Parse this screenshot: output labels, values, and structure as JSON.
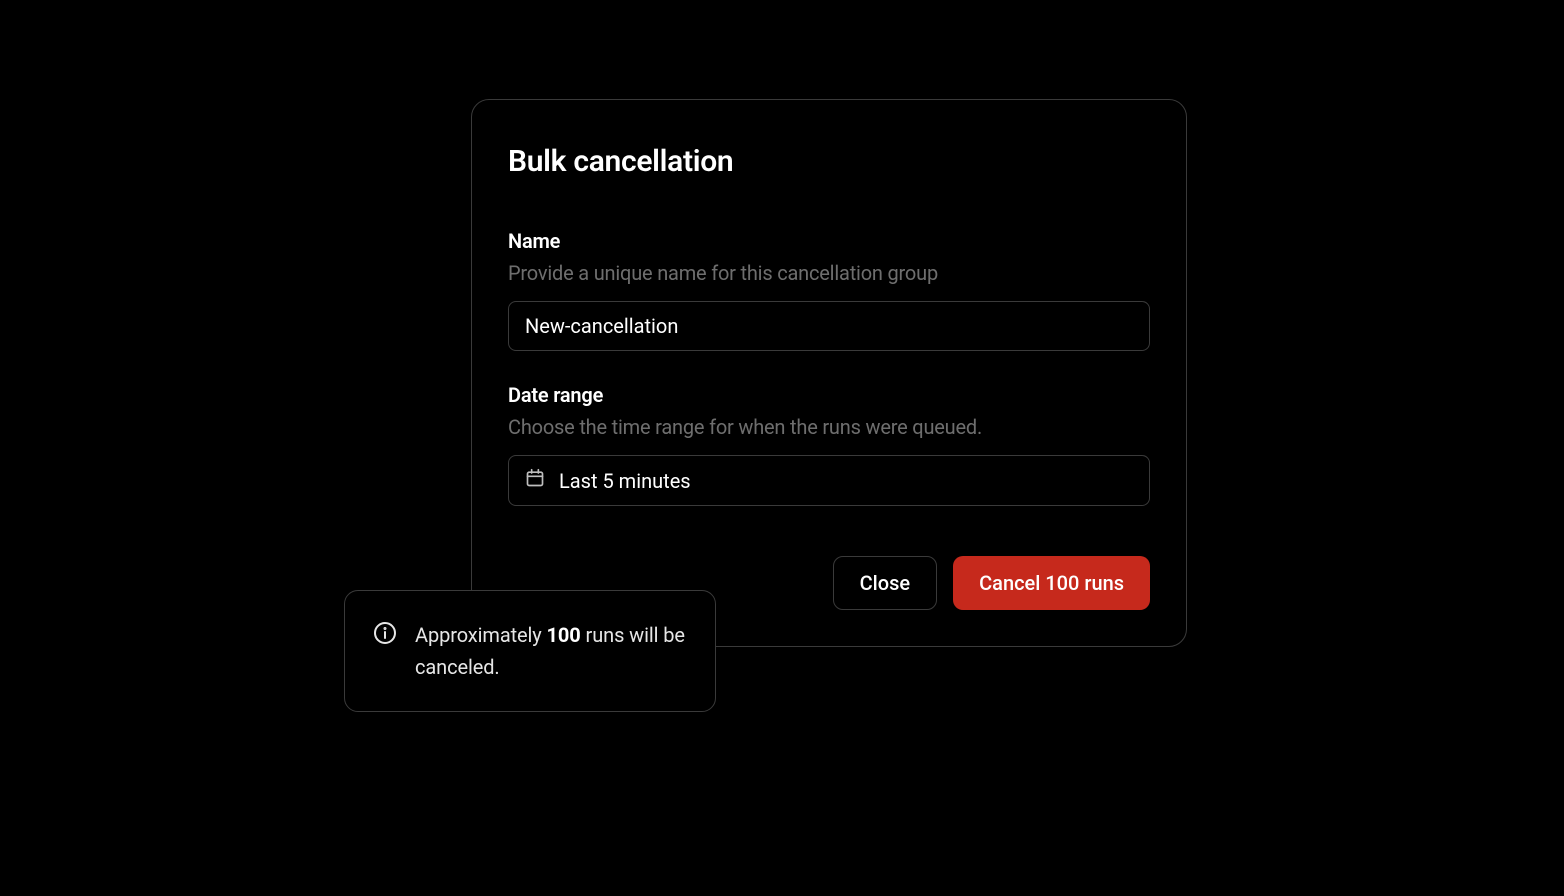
{
  "dialog": {
    "title": "Bulk cancellation",
    "name": {
      "label": "Name",
      "hint": "Provide a unique name for this cancellation group",
      "value": "New-cancellation"
    },
    "date_range": {
      "label": "Date range",
      "hint": "Choose the time range for when the runs were queued.",
      "value": "Last 5 minutes"
    },
    "footer": {
      "close_label": "Close",
      "cancel_label": "Cancel 100 runs"
    }
  },
  "toast": {
    "prefix": "Approximately ",
    "bold": "100",
    "middle": " runs will be canceled."
  },
  "colors": {
    "danger": "#c6291c",
    "border": "#3a3a3a",
    "hint": "#6e6e6e"
  }
}
